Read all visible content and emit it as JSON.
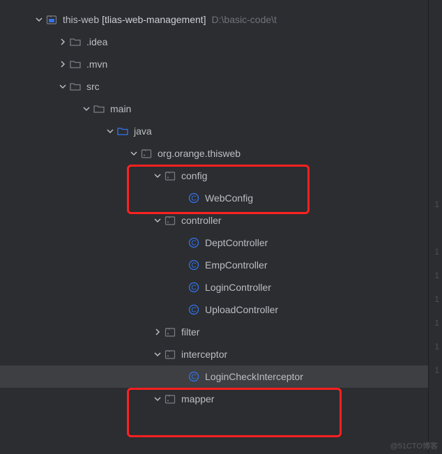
{
  "root": {
    "label": "this-web",
    "bracket": "[tlias-web-management]",
    "path_hint": "D:\\basic-code\\t"
  },
  "nodes": {
    "idea": ".idea",
    "mvn": ".mvn",
    "src": "src",
    "main": "main",
    "java": "java",
    "package_root": "org.orange.thisweb",
    "config": "config",
    "webconfig": "WebConfig",
    "controller": "controller",
    "deptcontroller": "DeptController",
    "empcontroller": "EmpController",
    "logincontroller": "LoginController",
    "uploadcontroller": "UploadController",
    "filter": "filter",
    "interceptor": "interceptor",
    "logincheckinterceptor": "LoginCheckInterceptor",
    "mapper": "mapper"
  },
  "gutter": [
    "1",
    "1",
    "1",
    "1",
    "1",
    "1",
    "1"
  ],
  "watermark": "@51CTO博客"
}
